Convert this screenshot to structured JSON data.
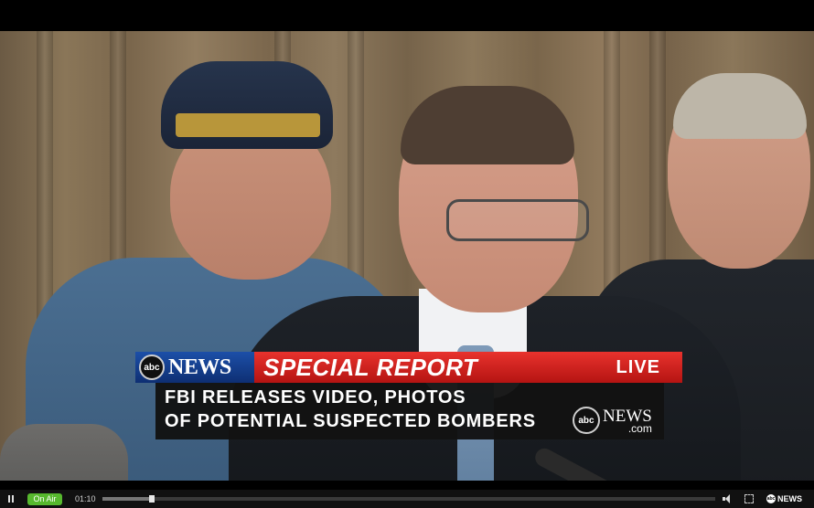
{
  "lower_third": {
    "network_logo": "abc",
    "network_word": "NEWS",
    "banner": "SPECIAL REPORT",
    "live": "LIVE",
    "headline_line1": "FBI RELEASES VIDEO, PHOTOS",
    "headline_line2": "OF POTENTIAL SUSPECTED BOMBERS",
    "bug_logo": "abc",
    "bug_news": "NEWS",
    "bug_com": ".com"
  },
  "player": {
    "on_air_label": "On Air",
    "elapsed": "01:10",
    "progress_percent": 8,
    "brand_logo": "abc",
    "brand_word": "NEWS",
    "icons": [
      "pause-icon",
      "volume-icon",
      "fullscreen-icon"
    ]
  },
  "colors": {
    "banner_red": "#d62520",
    "news_blue": "#1c4fa8",
    "on_air_green": "#57b92e"
  }
}
